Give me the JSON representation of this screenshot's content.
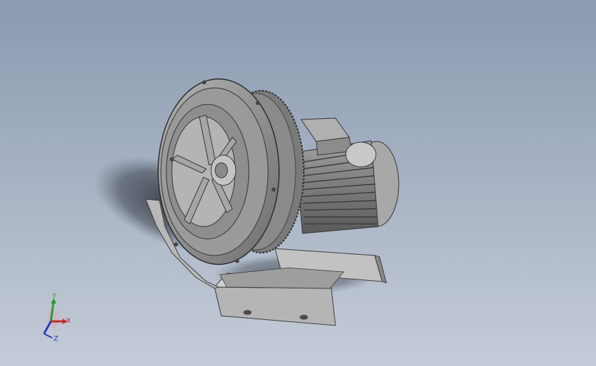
{
  "viewport": {
    "background_top": "#8a9ab0",
    "background_bottom": "#c5ccd8",
    "model": "side-channel-blower"
  },
  "triad": {
    "x_label": "X",
    "y_label": "Y",
    "z_label": "Z",
    "x_color": "#c0282a",
    "y_color": "#2a9a3a",
    "z_color": "#2a3ab8"
  }
}
